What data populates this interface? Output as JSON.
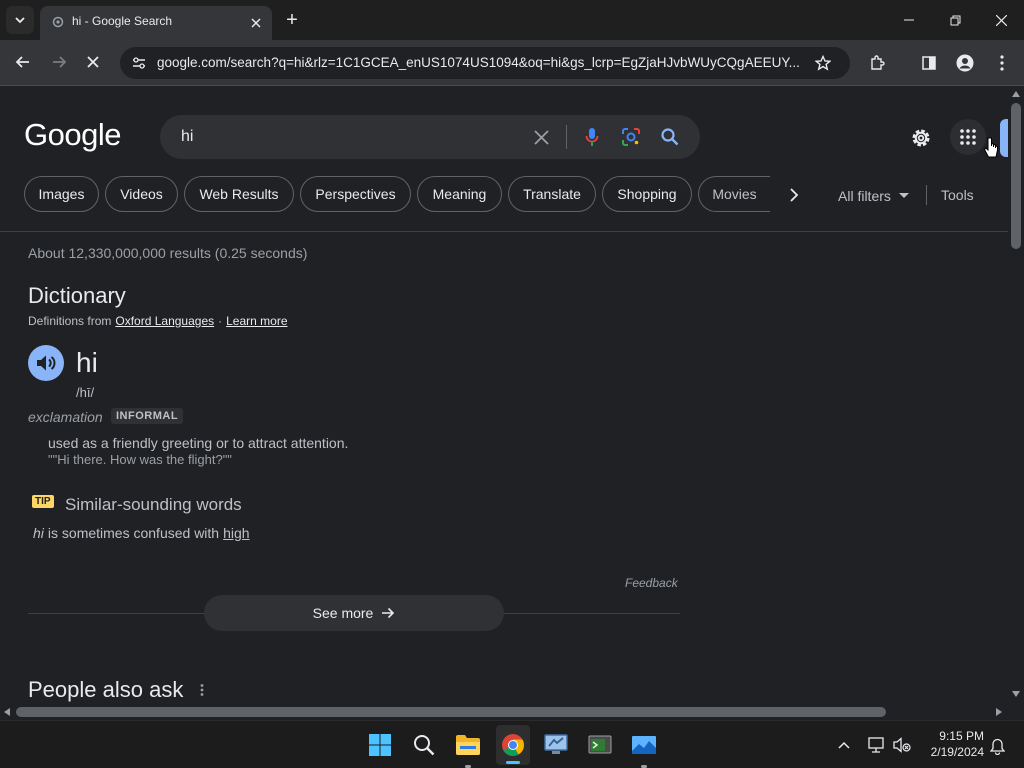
{
  "browser": {
    "tab_title": "hi - Google Search",
    "new_tab_symbol": "+",
    "url": "google.com/search?q=hi&rlz=1C1GCEA_enUS1074US1094&oq=hi&gs_lcrp=EgZjaHJvbWUyCQgAEEUY..."
  },
  "google": {
    "logo": "Google",
    "query": "hi",
    "chips": [
      "Images",
      "Videos",
      "Web Results",
      "Perspectives",
      "Meaning",
      "Translate",
      "Shopping",
      "Movies"
    ],
    "all_filters": "All filters",
    "tools": "Tools",
    "results_count": "About 12,330,000,000 results (0.25 seconds)"
  },
  "dictionary": {
    "heading": "Dictionary",
    "definitions_from": "Definitions from",
    "source": "Oxford Languages",
    "separator": "·",
    "learn_more": "Learn more",
    "word": "hi",
    "phonetic": "/hī/",
    "part_of_speech": "exclamation",
    "register_badge": "INFORMAL",
    "definition": "used as a friendly greeting or to attract attention.",
    "example": "\"\"Hi there. How was the flight?\"\"",
    "tip_badge": "TIP",
    "similar_heading": "Similar-sounding words",
    "similar_word": "hi",
    "similar_text": "is sometimes confused with",
    "similar_target": "high",
    "feedback": "Feedback",
    "see_more": "See more"
  },
  "people_also_ask": {
    "heading": "People also ask"
  },
  "taskbar": {
    "time": "9:15 PM",
    "date": "2/19/2024"
  },
  "colors": {
    "page_bg": "#202124",
    "chrome_bg": "#35363a",
    "accent_blue": "#8ab4f8",
    "text": "#e8eaed"
  }
}
